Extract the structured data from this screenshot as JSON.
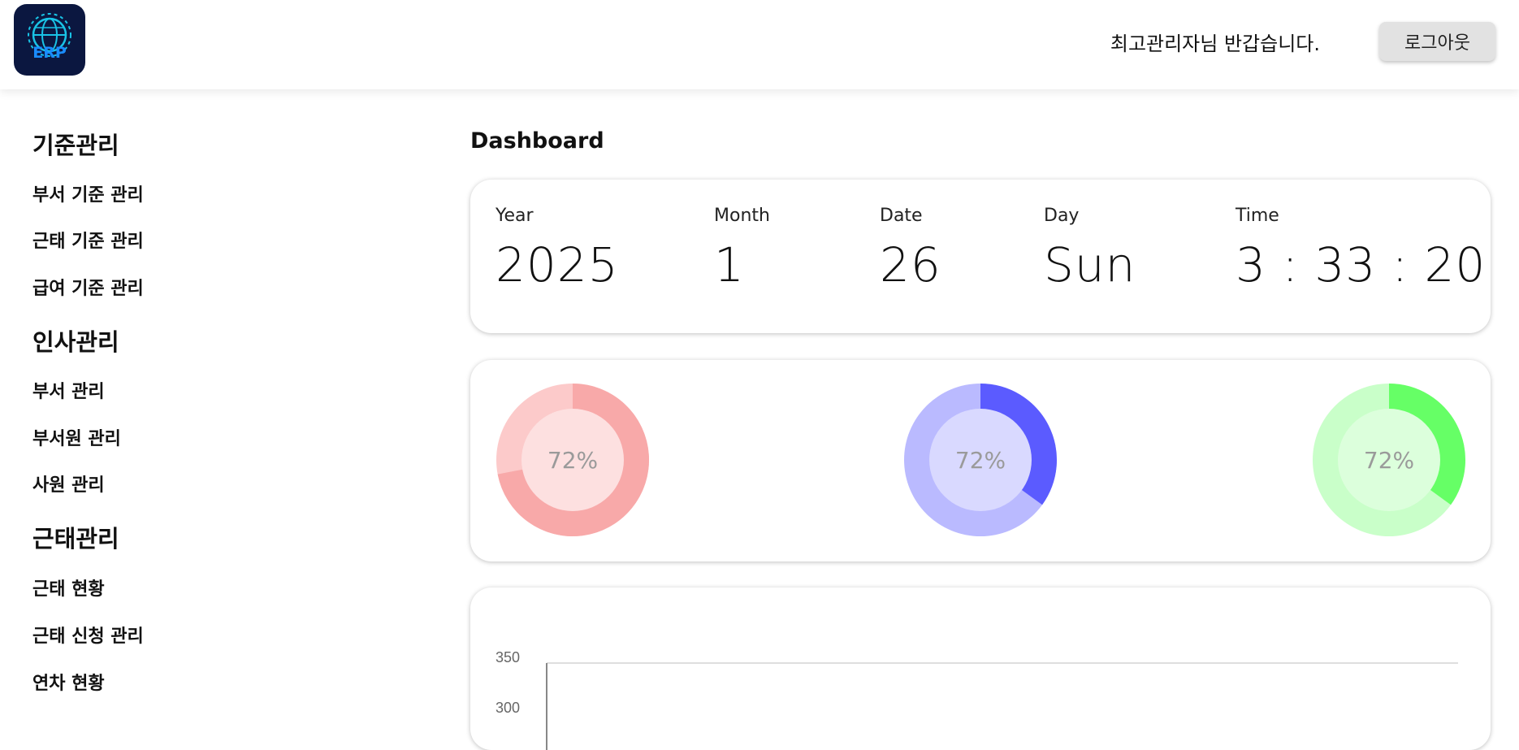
{
  "header": {
    "logo_text": "ERP",
    "greeting": "최고관리자님 반갑습니다.",
    "logout_label": "로그아웃"
  },
  "sidebar": {
    "sections": [
      {
        "title": "기준관리",
        "items": [
          "부서 기준 관리",
          "근태 기준 관리",
          "급여 기준 관리"
        ]
      },
      {
        "title": "인사관리",
        "items": [
          "부서 관리",
          "부서원 관리",
          "사원 관리"
        ]
      },
      {
        "title": "근태관리",
        "items": [
          "근태 현황",
          "근태 신청 관리",
          "연차 현황"
        ]
      }
    ]
  },
  "main": {
    "title": "Dashboard",
    "clock": {
      "year_label": "Year",
      "year": "2025",
      "month_label": "Month",
      "month": "1",
      "date_label": "Date",
      "date": "26",
      "day_label": "Day",
      "day": "Sun",
      "time_label": "Time",
      "time": "3 : 33 : 20"
    },
    "donuts": [
      {
        "label": "72%",
        "percent": 72,
        "fill": "#f8a9a9",
        "base": "#fccaca",
        "inner": "#fde0e0"
      },
      {
        "label": "72%",
        "percent": 35,
        "fill": "#5b5bff",
        "base": "#babaff",
        "inner": "#d9d9ff"
      },
      {
        "label": "72%",
        "percent": 35,
        "fill": "#66ff66",
        "base": "#c9ffc9",
        "inner": "#dcffdc"
      }
    ],
    "chart": {
      "ytick_labels": [
        "350",
        "300"
      ]
    }
  }
}
